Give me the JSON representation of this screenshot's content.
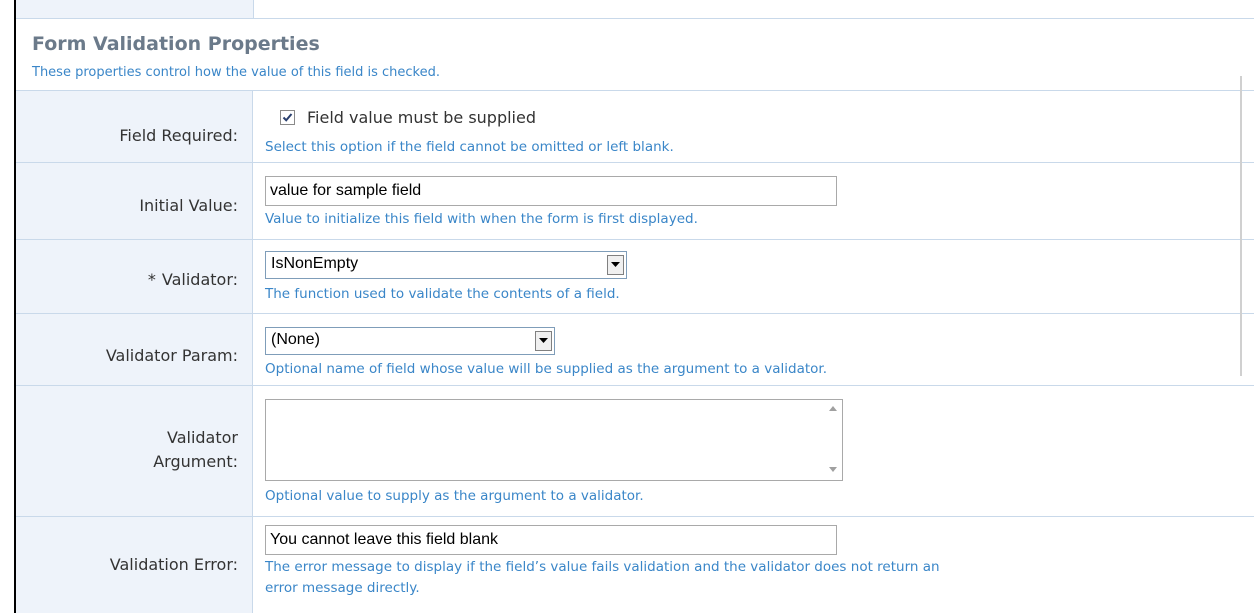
{
  "section": {
    "title": "Form Validation Properties",
    "description": "These properties control how the value of this field is checked."
  },
  "fields": {
    "required": {
      "label": "Field Required:",
      "checkbox_label": "Field value must be supplied",
      "checked": true,
      "help": "Select this option if the field cannot be omitted or left blank."
    },
    "initial_value": {
      "label": "Initial Value:",
      "value": "value for sample field",
      "help": "Value to initialize this field with when the form is first displayed."
    },
    "validator": {
      "required_marker": "*",
      "label": "Validator:",
      "selected": "IsNonEmpty",
      "help": "The function used to validate the contents of a field."
    },
    "validator_param": {
      "label": "Validator Param:",
      "selected": "(None)",
      "help": "Optional name of field whose value will be supplied as the argument to a validator."
    },
    "validator_argument": {
      "label_line1": "Validator",
      "label_line2": "Argument:",
      "value": "",
      "help": "Optional value to supply as the argument to a validator."
    },
    "validation_error": {
      "label": "Validation Error:",
      "value": "You cannot leave this field blank",
      "help_line1": "The error message to display if the field’s value fails validation and the validator does not return an",
      "help_line2": "error message directly."
    }
  },
  "colors": {
    "label_bg": "#eef3fa",
    "border": "#c9d9ea",
    "help_text": "#3a86c8",
    "title_text": "#6b7a8a"
  },
  "icons": [
    "checkmark-icon",
    "dropdown-arrow-icon",
    "scroll-up-icon",
    "scroll-down-icon"
  ]
}
